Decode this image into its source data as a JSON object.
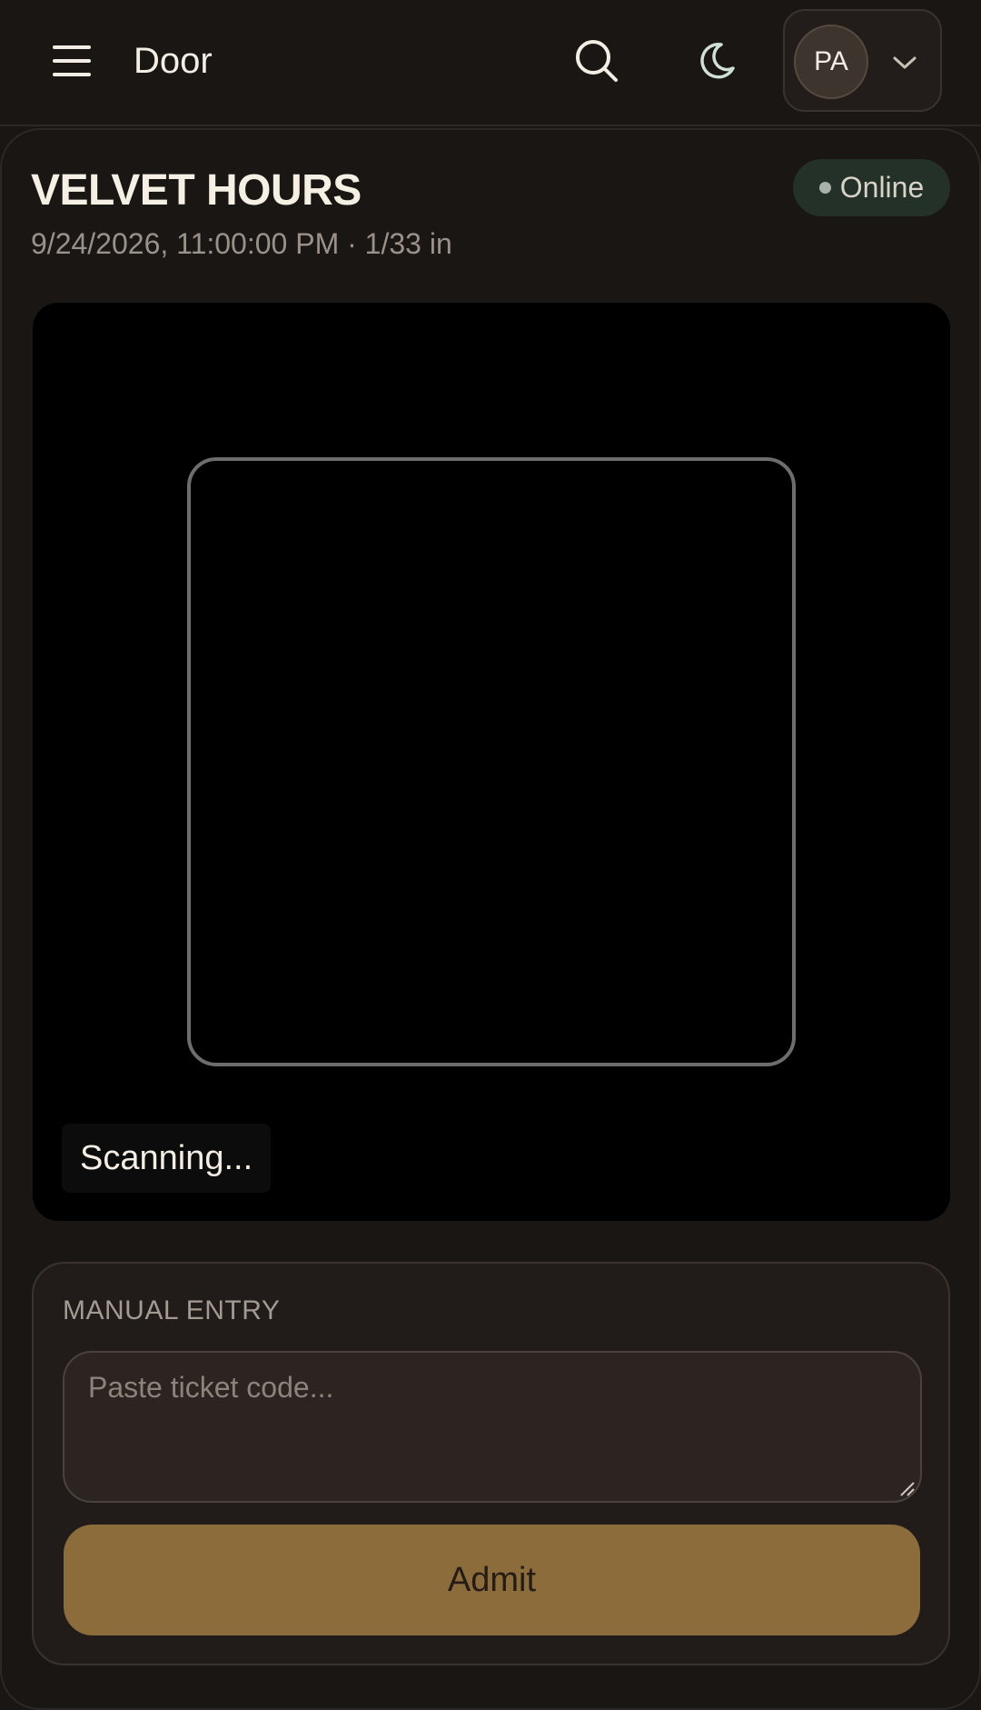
{
  "header": {
    "title": "Door",
    "menu_icon": "hamburger-menu-icon",
    "search_icon": "search-icon",
    "theme_icon": "moon-icon",
    "user": {
      "initials": "PA",
      "chevron_icon": "chevron-down-icon"
    }
  },
  "event": {
    "name": "VELVET HOURS",
    "meta": "9/24/2026, 11:00:00 PM · 1/33 in",
    "status": "Online",
    "status_color": "#233128"
  },
  "scanner": {
    "status_text": "Scanning..."
  },
  "manual_entry": {
    "label": "MANUAL ENTRY",
    "placeholder": "Paste ticket code...",
    "value": "",
    "submit_label": "Admit",
    "submit_color": "#8b6c3a"
  }
}
